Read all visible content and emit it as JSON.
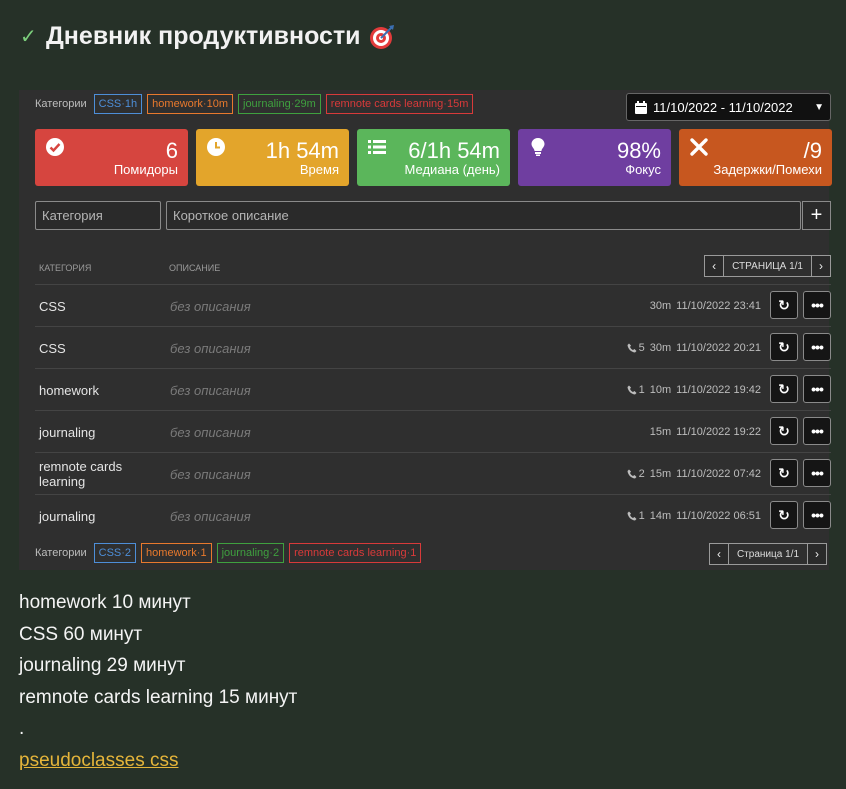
{
  "page": {
    "title": "Дневник продуктивности"
  },
  "top_categories": {
    "label": "Категории",
    "tags": [
      {
        "name": "CSS",
        "value": "1h",
        "color": "#4d8ed8"
      },
      {
        "name": "homework",
        "value": "10m",
        "color": "#e8792d"
      },
      {
        "name": "journaling",
        "value": "29m",
        "color": "#3fa03f"
      },
      {
        "name": "remnote cards learning",
        "value": "15m",
        "color": "#d83a3a"
      }
    ]
  },
  "date_range": "11/10/2022 - 11/10/2022",
  "stats": [
    {
      "value": "6",
      "label": "Помидоры",
      "color": "#d6453f",
      "icon": "check-circle-icon"
    },
    {
      "value": "1h 54m",
      "label": "Время",
      "color": "#e3a52b",
      "icon": "clock-icon"
    },
    {
      "value": "6/1h 54m",
      "label": "Медиана (день)",
      "color": "#5bb65b",
      "icon": "list-icon"
    },
    {
      "value": "98%",
      "label": "Фокус",
      "color": "#6f3ea0",
      "icon": "lightbulb-icon"
    },
    {
      "value": "/9",
      "label": "Задержки/Помехи",
      "color": "#c7571f",
      "icon": "x-icon"
    }
  ],
  "inputs": {
    "category_placeholder": "Категория",
    "description_placeholder": "Короткое описание",
    "add_label": "+"
  },
  "table": {
    "col_category": "КАТЕГОРИЯ",
    "col_description": "ОПИСАНИЕ",
    "pager_text": "Страница 1/1",
    "rows": [
      {
        "category": "CSS",
        "description": "без описания",
        "interruptions": "",
        "duration": "30m",
        "datetime": "11/10/2022 23:41"
      },
      {
        "category": "CSS",
        "description": "без описания",
        "interruptions": "5",
        "duration": "30m",
        "datetime": "11/10/2022 20:21"
      },
      {
        "category": "homework",
        "description": "без описания",
        "interruptions": "1",
        "duration": "10m",
        "datetime": "11/10/2022 19:42"
      },
      {
        "category": "journaling",
        "description": "без описания",
        "interruptions": "",
        "duration": "15m",
        "datetime": "11/10/2022 19:22"
      },
      {
        "category": "remnote cards learning",
        "description": "без описания",
        "interruptions": "2",
        "duration": "15m",
        "datetime": "11/10/2022 07:42"
      },
      {
        "category": "journaling",
        "description": "без описания",
        "interruptions": "1",
        "duration": "14m",
        "datetime": "11/10/2022 06:51"
      }
    ]
  },
  "bottom_categories": {
    "label": "Категории",
    "pager_text": "Страница 1/1",
    "tags": [
      {
        "name": "CSS",
        "value": "2",
        "color": "#4d8ed8"
      },
      {
        "name": "homework",
        "value": "1",
        "color": "#e8792d"
      },
      {
        "name": "journaling",
        "value": "2",
        "color": "#3fa03f"
      },
      {
        "name": "remnote cards learning",
        "value": "1",
        "color": "#d83a3a"
      }
    ]
  },
  "summary": {
    "lines": [
      "homework 10 минут",
      "CSS 60 минут",
      "journaling 29 минут",
      "remnote cards learning 15 минут"
    ],
    "dot": ".",
    "link": "pseudoclasses css"
  }
}
